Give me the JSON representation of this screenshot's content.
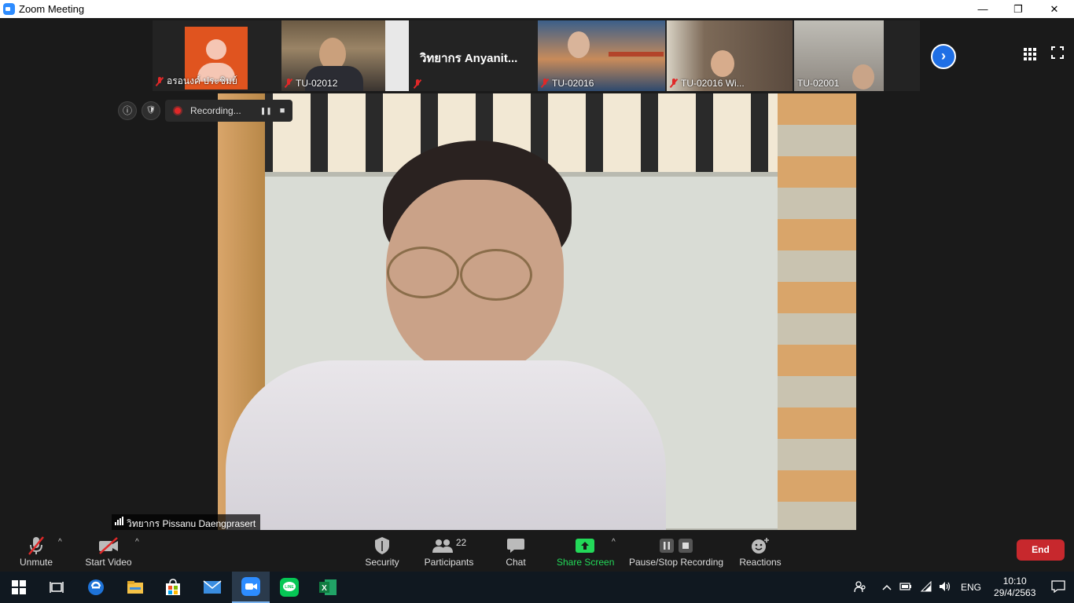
{
  "window": {
    "title": "Zoom Meeting",
    "minimize": "—",
    "restore": "❐",
    "close": "✕"
  },
  "thumbnails": [
    {
      "name": "อรอนงค์ ประชิมย์",
      "muted": true,
      "type": "avatar"
    },
    {
      "name": "TU-02012",
      "muted": true,
      "type": "video"
    },
    {
      "name": "",
      "title": "วิทยากร Anyanit...",
      "muted": true,
      "type": "title"
    },
    {
      "name": "TU-02016",
      "muted": true,
      "type": "video"
    },
    {
      "name": "TU-02016 Wi...",
      "muted": true,
      "type": "video"
    },
    {
      "name": "TU-02001",
      "muted": false,
      "type": "video"
    }
  ],
  "next_button": "›",
  "recording": {
    "label": "Recording...",
    "info_icon": "ⓘ",
    "shield_icon": "🛡",
    "pause_icon": "❚❚",
    "stop_icon": "■"
  },
  "speaker": {
    "name": "วิทยากร Pissanu Daengprasert"
  },
  "toolbar": {
    "unmute": "Unmute",
    "start_video": "Start Video",
    "security": "Security",
    "participants": "Participants",
    "participants_count": "22",
    "chat": "Chat",
    "share_screen": "Share Screen",
    "pause_stop_recording": "Pause/Stop Recording",
    "reactions": "Reactions",
    "end": "End",
    "caret": "^"
  },
  "taskbar": {
    "language": "ENG",
    "time": "10:10",
    "date": "29/4/2563"
  },
  "colors": {
    "accent": "#2d8cff",
    "share_green": "#23d959",
    "end_red": "#c7282d",
    "muted_red": "#e02828"
  }
}
